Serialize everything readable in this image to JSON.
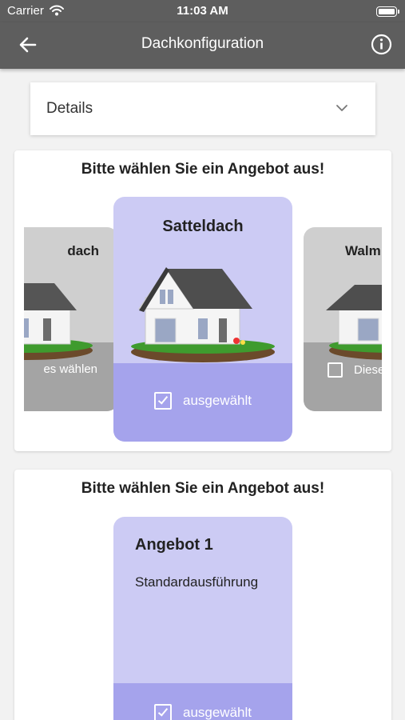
{
  "status_bar": {
    "carrier": "Carrier",
    "time": "11:03 AM"
  },
  "app_bar": {
    "title": "Dachkonfiguration",
    "back_icon": "arrow-left-icon",
    "info_icon": "info-circle-icon"
  },
  "details": {
    "label": "Details",
    "icon": "chevron-down-icon"
  },
  "roof_selection": {
    "heading": "Bitte wählen Sie ein Angebot aus!",
    "cards": [
      {
        "name": "dach",
        "select_label": "es wählen",
        "selected": false
      },
      {
        "name": "Satteldach",
        "select_label": "ausgewählt",
        "selected": true
      },
      {
        "name": "Walm",
        "select_label": "Diese",
        "selected": false
      }
    ]
  },
  "offer_selection": {
    "heading": "Bitte wählen Sie ein Angebot aus!",
    "offers": [
      {
        "name": "Angebot 1",
        "description": "Standardausführung",
        "select_label": "ausgewählt",
        "selected": true
      }
    ]
  },
  "colors": {
    "app_bar": "#5e5e5e",
    "card_selected": "#cccbf4",
    "card_selected_footer": "#a5a3ec",
    "card_unselected": "#cfcfcf",
    "card_unselected_footer": "#a4a4a4"
  }
}
